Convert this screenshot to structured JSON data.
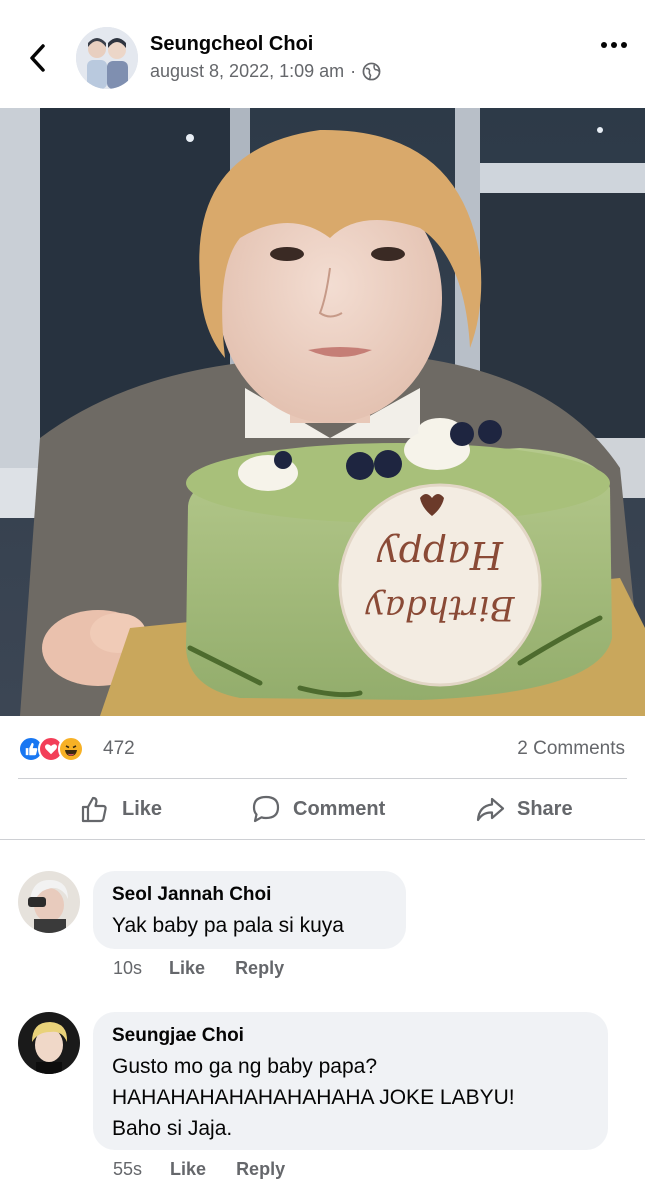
{
  "post": {
    "author": "Seungcheol Choi",
    "timestamp": "august 8, 2022, 1:09 am",
    "separator": "·",
    "privacy_icon": "globe-icon",
    "cake_text_line1": "Happy",
    "cake_text_line2": "Birthday"
  },
  "reactions": {
    "icons": [
      "like-icon",
      "love-icon",
      "haha-icon"
    ],
    "count": "472",
    "comments_count": "2 Comments"
  },
  "actions": {
    "like": "Like",
    "comment": "Comment",
    "share": "Share"
  },
  "comments": [
    {
      "name": "Seol Jannah Choi",
      "text": "Yak baby pa pala si kuya",
      "time": "10s",
      "like": "Like",
      "reply": "Reply"
    },
    {
      "name": "Seungjae Choi",
      "text_lines": [
        "Gusto mo ga ng baby papa?",
        "HAHAHAHAHAHAHAHAHA JOKE LABYU!",
        "Baho si Jaja."
      ],
      "time": "55s",
      "like": "Like",
      "reply": "Reply"
    }
  ],
  "colors": {
    "text_primary": "#050505",
    "text_secondary": "#65676b",
    "bubble_bg": "#f0f2f5",
    "divider": "#ced0d4",
    "like_blue": "#1877f2",
    "love_red": "#f33e58",
    "haha_yellow": "#f7b125"
  }
}
